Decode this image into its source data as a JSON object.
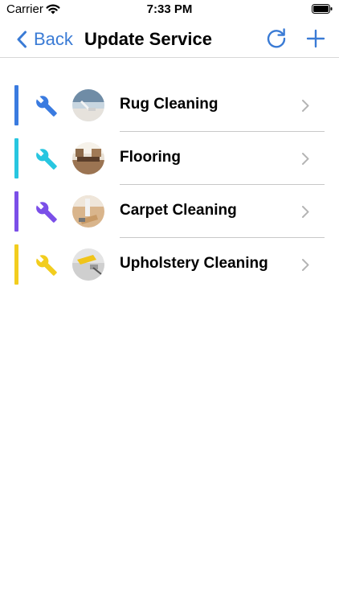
{
  "status_bar": {
    "carrier": "Carrier",
    "time": "7:33 PM"
  },
  "nav": {
    "back_label": "Back",
    "title": "Update Service"
  },
  "colors": {
    "accent": "#3a7bd5"
  },
  "services": [
    {
      "label": "Rug Cleaning",
      "color": "#3a7be0",
      "icon": "wrench-icon"
    },
    {
      "label": "Flooring",
      "color": "#28c6e0",
      "icon": "wrench-icon"
    },
    {
      "label": "Carpet Cleaning",
      "color": "#7b4fe8",
      "icon": "wrench-icon"
    },
    {
      "label": "Upholstery Cleaning",
      "color": "#f2cd1e",
      "icon": "wrench-icon"
    }
  ]
}
